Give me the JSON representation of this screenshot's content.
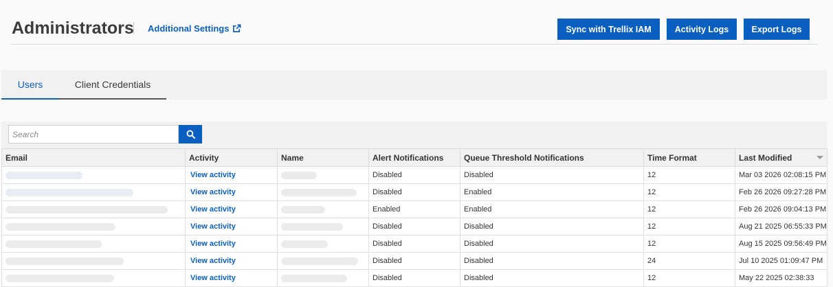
{
  "header": {
    "title": "Administrators",
    "additional_link": "Additional Settings",
    "buttons": {
      "sync": "Sync with Trellix IAM",
      "activity": "Activity Logs",
      "export": "Export Logs"
    }
  },
  "tabs": [
    {
      "label": "Users",
      "active": true
    },
    {
      "label": "Client Credentials",
      "active": false
    }
  ],
  "search": {
    "placeholder": "Search"
  },
  "table": {
    "columns": [
      "Email",
      "Activity",
      "Name",
      "Alert Notifications",
      "Queue Threshold Notifications",
      "Time Format",
      "Last Modified"
    ],
    "sorted_column": "Last Modified",
    "sort_direction": "descending",
    "rows": [
      {
        "activity": "View activity",
        "alert": "Disabled",
        "queue": "Disabled",
        "time_format": "12",
        "modified": "Mar 03 2026 02:08:15 PM"
      },
      {
        "activity": "View activity",
        "alert": "Disabled",
        "queue": "Enabled",
        "time_format": "12",
        "modified": "Feb 26 2026 09:27:28 PM"
      },
      {
        "activity": "View activity",
        "alert": "Enabled",
        "queue": "Enabled",
        "time_format": "12",
        "modified": "Feb 26 2026 09:04:13 PM"
      },
      {
        "activity": "View activity",
        "alert": "Disabled",
        "queue": "Disabled",
        "time_format": "12",
        "modified": "Aug 21 2025 06:55:33 PM"
      },
      {
        "activity": "View activity",
        "alert": "Disabled",
        "queue": "Disabled",
        "time_format": "12",
        "modified": "Aug 15 2025 09:56:49 PM"
      },
      {
        "activity": "View activity",
        "alert": "Disabled",
        "queue": "Disabled",
        "time_format": "24",
        "modified": "Jul 10 2025 01:09:47 PM"
      },
      {
        "activity": "View activity",
        "alert": "Disabled",
        "queue": "Disabled",
        "time_format": "12",
        "modified": "May 22 2025 02:38:33"
      }
    ]
  },
  "colors": {
    "accent": "#0b5fc1",
    "background": "#fafafa",
    "panel": "#f1f1f1"
  },
  "icons": {
    "external_link": "external-link-icon",
    "search": "search-icon",
    "sort": "sort-down-icon"
  }
}
